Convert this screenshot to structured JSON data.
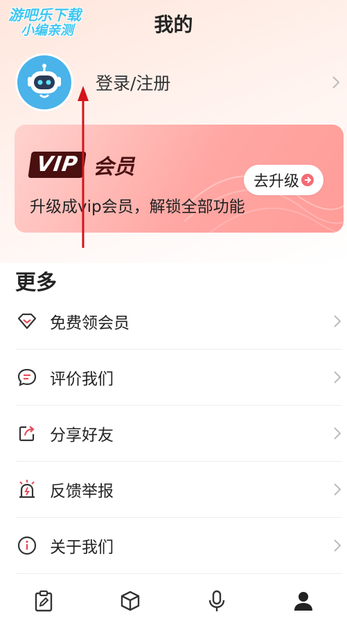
{
  "watermark": {
    "line1": "游吧乐下载",
    "line2": "小编亲测"
  },
  "header": {
    "title": "我的"
  },
  "profile": {
    "login_label": "登录/注册",
    "avatar_icon": "robot-avatar-icon"
  },
  "vip": {
    "badge": "VIP",
    "badge_cn": "会员",
    "description": "升级成vip会员，解锁全部功能",
    "upgrade_label": "去升级",
    "accent": "#f46b74"
  },
  "more": {
    "title": "更多",
    "items": [
      {
        "label": "免费领会员",
        "icon": "diamond-icon"
      },
      {
        "label": "评价我们",
        "icon": "chat-bubble-icon"
      },
      {
        "label": "分享好友",
        "icon": "share-icon"
      },
      {
        "label": "反馈举报",
        "icon": "alarm-icon"
      },
      {
        "label": "关于我们",
        "icon": "info-icon"
      }
    ]
  },
  "tabbar": {
    "tabs": [
      {
        "icon": "clipboard-edit-icon"
      },
      {
        "icon": "cube-icon"
      },
      {
        "icon": "microphone-icon"
      },
      {
        "icon": "person-icon"
      }
    ]
  }
}
